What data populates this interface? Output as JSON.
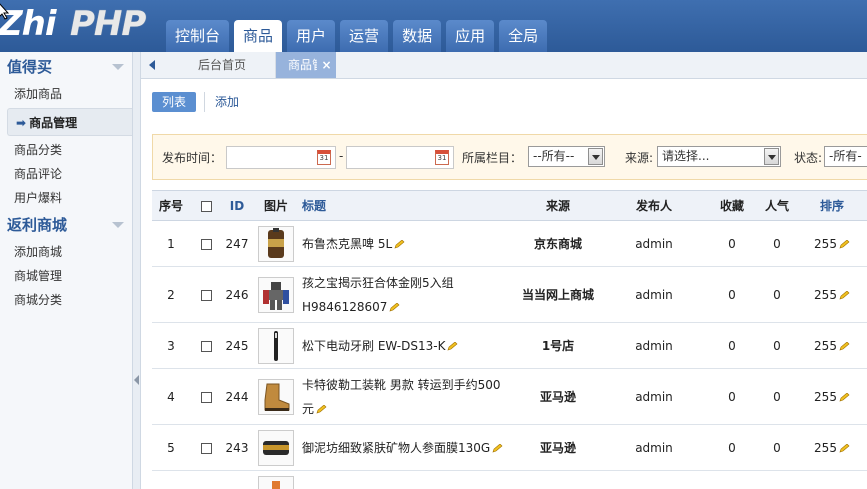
{
  "logo": {
    "part1": "Zhi",
    "part2": "PHP"
  },
  "nav": {
    "tabs": [
      {
        "label": "控制台",
        "active": false
      },
      {
        "label": "商品",
        "active": true
      },
      {
        "label": "用户",
        "active": false
      },
      {
        "label": "运营",
        "active": false
      },
      {
        "label": "数据",
        "active": false
      },
      {
        "label": "应用",
        "active": false
      },
      {
        "label": "全局",
        "active": false
      }
    ]
  },
  "sidebar": {
    "groups": [
      {
        "title": "值得买",
        "items": [
          "添加商品",
          "商品管理",
          "商品分类",
          "商品评论",
          "用户爆料"
        ]
      },
      {
        "title": "返利商城",
        "items": [
          "添加商城",
          "商城管理",
          "商城分类"
        ]
      }
    ],
    "active_item": "商品管理"
  },
  "page_tabs": {
    "home": "后台首页",
    "current": "商品管理",
    "close": "×"
  },
  "subtabs": {
    "list": "列表",
    "add": "添加"
  },
  "filter": {
    "publish_time_label": "发布时间：",
    "date_sep": "-",
    "calendar_day": "31",
    "category_label": "所属栏目：",
    "category_value": "--所有--",
    "source_label": "来源:",
    "source_value": "请选择...",
    "status_label": "状态:",
    "status_value": "-所有-"
  },
  "table": {
    "headers": {
      "seq": "序号",
      "id": "ID",
      "image": "图片",
      "title": "标题",
      "source": "来源",
      "publisher": "发布人",
      "favorites": "收藏",
      "popularity": "人气",
      "sort": "排序"
    },
    "rows": [
      {
        "seq": "1",
        "id": "247",
        "title": "布鲁杰克黑啤 5L",
        "source": "京东商城",
        "publisher": "admin",
        "favorites": "0",
        "popularity": "0",
        "sort": "255"
      },
      {
        "seq": "2",
        "id": "246",
        "title": "孩之宝揭示狂合体金刚5入组H9846128607",
        "source": "当当网上商城",
        "publisher": "admin",
        "favorites": "0",
        "popularity": "0",
        "sort": "255"
      },
      {
        "seq": "3",
        "id": "245",
        "title": "松下电动牙刷 EW-DS13-K",
        "source": "1号店",
        "publisher": "admin",
        "favorites": "0",
        "popularity": "0",
        "sort": "255"
      },
      {
        "seq": "4",
        "id": "244",
        "title": "卡特彼勒工装靴 男款 转运到手约500元",
        "source": "亚马逊",
        "publisher": "admin",
        "favorites": "0",
        "popularity": "0",
        "sort": "255"
      },
      {
        "seq": "5",
        "id": "243",
        "title": "御泥坊细致紧肤矿物人参面膜130G",
        "source": "亚马逊",
        "publisher": "admin",
        "favorites": "0",
        "popularity": "0",
        "sort": "255"
      }
    ]
  },
  "colors": {
    "header_blue": "#2d5a98",
    "active_subtab": "#5b8fd1",
    "filter_bg": "#fff8ea"
  }
}
